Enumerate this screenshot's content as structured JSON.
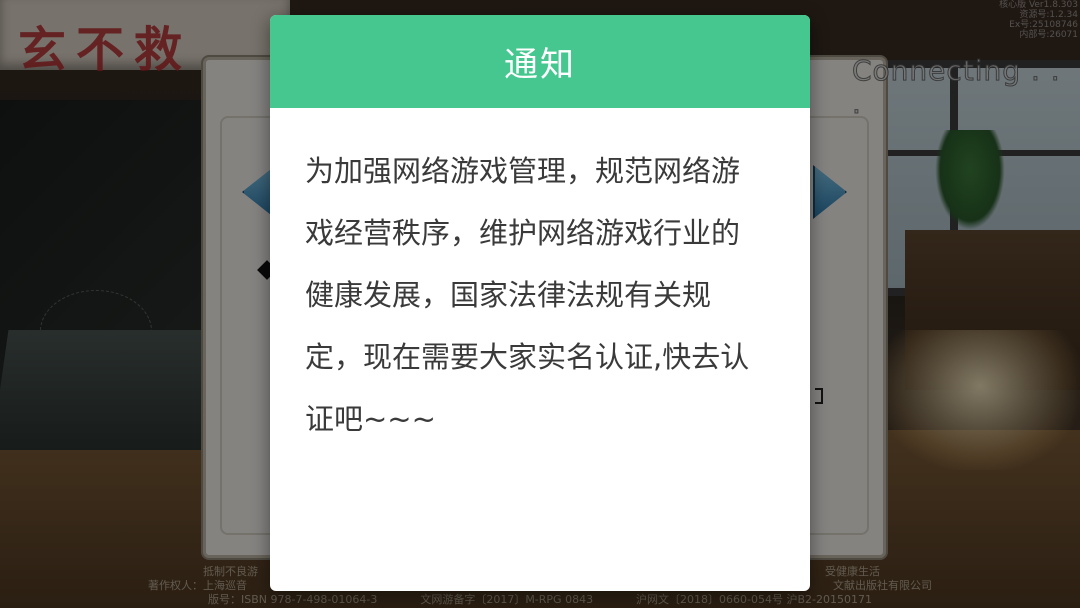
{
  "background": {
    "banner_text": "玄不救",
    "connecting_text": "Connecting . . .",
    "version_lines": [
      "核心版 Ver1.8.303",
      "资源号:1.2.34",
      "Ex号:25108746",
      "内部号:26071"
    ],
    "footer": {
      "line1_left": "抵制不良游",
      "line1_right": "受健康生活",
      "line2_left": "著作权人：上海巡音",
      "line2_right": "文献出版社有限公司",
      "line3_left": "版号：ISBN 978-7-498-01064-3",
      "line3_mid": "文网游备字〔2017〕M-RPG 0843",
      "line3_right": "沪网文〔2018〕0660-054号   沪B2-20150171"
    }
  },
  "notice": {
    "title": "通知",
    "body": "为加强网络游戏管理，规范网络游戏经营秩序，维护网络游戏行业的健康发展，国家法律法规有关规定，现在需要大家实名认证,快去认证吧~~~"
  },
  "colors": {
    "header_bg": "#45c78f",
    "header_text": "#ffffff",
    "body_text": "#3a3a3a"
  },
  "icons": {
    "left_arrow": "chevron-left-icon",
    "right_arrow": "chevron-right-icon"
  }
}
